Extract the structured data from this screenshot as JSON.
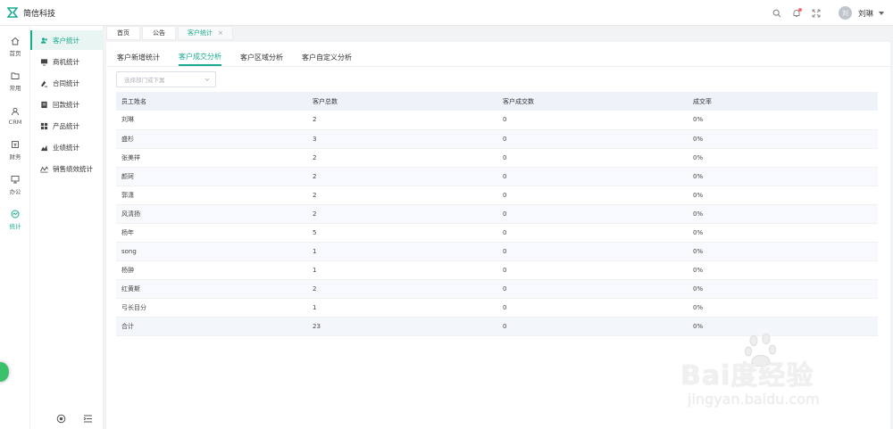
{
  "app": {
    "name": "简信科技"
  },
  "user": {
    "avatar_text": "刘",
    "name": "刘琳"
  },
  "rail": [
    {
      "label": "首页",
      "icon": "home-icon"
    },
    {
      "label": "常用",
      "icon": "folder-icon"
    },
    {
      "label": "CRM",
      "icon": "crm-icon"
    },
    {
      "label": "财务",
      "icon": "finance-icon"
    },
    {
      "label": "办公",
      "icon": "monitor-icon"
    },
    {
      "label": "统计",
      "icon": "stats-icon"
    }
  ],
  "submenu": [
    {
      "label": "客户统计",
      "icon": "customer-icon"
    },
    {
      "label": "商机统计",
      "icon": "opportunity-icon"
    },
    {
      "label": "合同统计",
      "icon": "contract-icon"
    },
    {
      "label": "回款统计",
      "icon": "payment-icon"
    },
    {
      "label": "产品统计",
      "icon": "product-icon"
    },
    {
      "label": "业绩统计",
      "icon": "performance-icon"
    },
    {
      "label": "销售绩效统计",
      "icon": "sales-performance-icon"
    }
  ],
  "tabs": [
    {
      "label": "首页"
    },
    {
      "label": "公告"
    },
    {
      "label": "客户统计",
      "close": "×"
    }
  ],
  "subtabs": [
    "客户新增统计",
    "客户成交分析",
    "客户区域分析",
    "客户自定义分析"
  ],
  "filter": {
    "placeholder": "选择部门或下属"
  },
  "table": {
    "columns": [
      "员工姓名",
      "客户总数",
      "客户成交数",
      "成交率"
    ],
    "rows": [
      [
        "刘琳",
        "2",
        "0",
        "0%"
      ],
      [
        "盛杉",
        "3",
        "0",
        "0%"
      ],
      [
        "张美祥",
        "2",
        "0",
        "0%"
      ],
      [
        "颜珂",
        "2",
        "0",
        "0%"
      ],
      [
        "郭潇",
        "2",
        "0",
        "0%"
      ],
      [
        "风清扬",
        "2",
        "0",
        "0%"
      ],
      [
        "杨年",
        "5",
        "0",
        "0%"
      ],
      [
        "song",
        "1",
        "0",
        "0%"
      ],
      [
        "杨翀",
        "1",
        "0",
        "0%"
      ],
      [
        "红黄斯",
        "2",
        "0",
        "0%"
      ],
      [
        "弓长目分",
        "1",
        "0",
        "0%"
      ],
      [
        "合计",
        "23",
        "0",
        "0%"
      ]
    ]
  },
  "watermark": {
    "main": "Bai度经验",
    "sub": "jingyan.baidu.com"
  },
  "colors": {
    "accent": "#1aaa8e",
    "header_bg": "#eef3fa",
    "notify_dot": "#f56c6c"
  }
}
